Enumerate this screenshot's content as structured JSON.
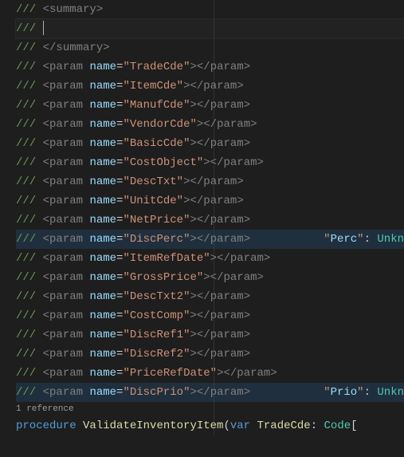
{
  "doc": {
    "summary_open": "summary",
    "summary_close": "/summary",
    "params": [
      {
        "name": "TradeCde",
        "highlight": false,
        "hint": null
      },
      {
        "name": "ItemCde",
        "highlight": false,
        "hint": null
      },
      {
        "name": "ManufCde",
        "highlight": false,
        "hint": null
      },
      {
        "name": "VendorCde",
        "highlight": false,
        "hint": null
      },
      {
        "name": "BasicCde",
        "highlight": false,
        "hint": null
      },
      {
        "name": "CostObject",
        "highlight": false,
        "hint": null
      },
      {
        "name": "DescTxt",
        "highlight": false,
        "hint": null
      },
      {
        "name": "UnitCde",
        "highlight": false,
        "hint": null
      },
      {
        "name": "NetPrice",
        "highlight": false,
        "hint": null
      },
      {
        "name": "DiscPerc",
        "highlight": true,
        "hint": {
          "key": "Perc",
          "val": "Unkn"
        }
      },
      {
        "name": "ItemRefDate",
        "highlight": false,
        "hint": null
      },
      {
        "name": "GrossPrice",
        "highlight": false,
        "hint": null
      },
      {
        "name": "DescTxt2",
        "highlight": false,
        "hint": null
      },
      {
        "name": "CostComp",
        "highlight": false,
        "hint": null
      },
      {
        "name": "DiscRef1",
        "highlight": false,
        "hint": null
      },
      {
        "name": "DiscRef2",
        "highlight": false,
        "hint": null
      },
      {
        "name": "PriceRefDate",
        "highlight": false,
        "hint": null
      },
      {
        "name": "DiscPrio",
        "highlight": true,
        "hint": {
          "key": "Prio",
          "val": "Unkn"
        }
      }
    ]
  },
  "codelens": "1 reference",
  "proc": {
    "kw_procedure": "procedure",
    "name": "ValidateInventoryItem",
    "kw_var": "var",
    "param1": "TradeCde",
    "type": "Code"
  },
  "tag_param": "param",
  "attr_name": "name"
}
